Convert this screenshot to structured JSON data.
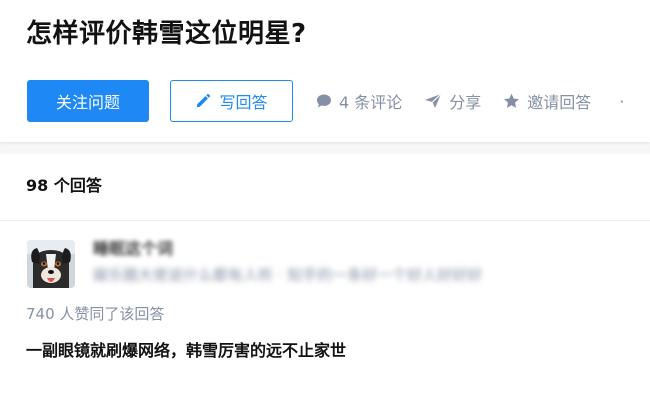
{
  "question": {
    "title": "怎样评价韩雪这位明星?"
  },
  "actions": {
    "follow_label": "关注问题",
    "answer_label": "写回答",
    "comments_label": "4 条评论",
    "share_label": "分享",
    "invite_label": "邀请回答",
    "more_label": "·"
  },
  "answers": {
    "count_label": "98 个回答",
    "items": [
      {
        "author_name": "睡眠这个词",
        "author_bio": "娱乐圈大佬说什么都有人听 · 知乎的一条好一个好人好好好",
        "votes_label": "740 人赞同了该回答",
        "excerpt_title": "一副眼镜就刷爆网络，韩雪厉害的远不止家世"
      }
    ]
  },
  "colors": {
    "brand": "#1e88f5",
    "muted": "#8590a6",
    "text": "#121212"
  }
}
